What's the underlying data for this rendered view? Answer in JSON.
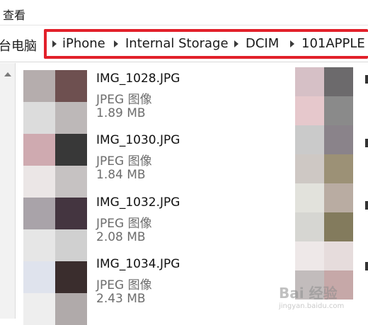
{
  "menu": {
    "view_label": "查看"
  },
  "breadcrumb": {
    "root": "台电脑",
    "items": [
      "iPhone",
      "Internal Storage",
      "DCIM",
      "101APPLE"
    ]
  },
  "files": [
    {
      "name": "IMG_1028.JPG",
      "type": "JPEG 图像",
      "size": "1.89 MB",
      "colors": [
        "#b5adad",
        "#6e5050",
        "#dcdcdc",
        "#bdb8b8"
      ]
    },
    {
      "name": "IMG_1030.JPG",
      "type": "JPEG 图像",
      "size": "1.84 MB",
      "colors": [
        "#cfaab0",
        "#383838",
        "#ebe6e6",
        "#c6c2c2"
      ]
    },
    {
      "name": "IMG_1032.JPG",
      "type": "JPEG 图像",
      "size": "2.08 MB",
      "colors": [
        "#a9a3a9",
        "#443540",
        "#e6e6e6",
        "#d0d0d0"
      ]
    },
    {
      "name": "IMG_1034.JPG",
      "type": "JPEG 图像",
      "size": "2.43 MB",
      "colors": [
        "#dfe3ed",
        "#3a2d2d",
        "#eeeeee",
        "#b0aaaa"
      ]
    }
  ],
  "right_column_colors": [
    "#d6c0c6",
    "#6c6a6c",
    "#e6c8cc",
    "#8a8a8a",
    "#cacaca",
    "#8a838a",
    "#cec8c4",
    "#9c9176",
    "#e2e2dc",
    "#b9aca2",
    "#d6d6d2",
    "#837b5d",
    "#eee8e8",
    "#e6dcdc",
    "#c2bcbc",
    "#c6a8a8"
  ],
  "watermark": {
    "text": "Bai 经验",
    "sub": "jingyan.baidu.com"
  }
}
